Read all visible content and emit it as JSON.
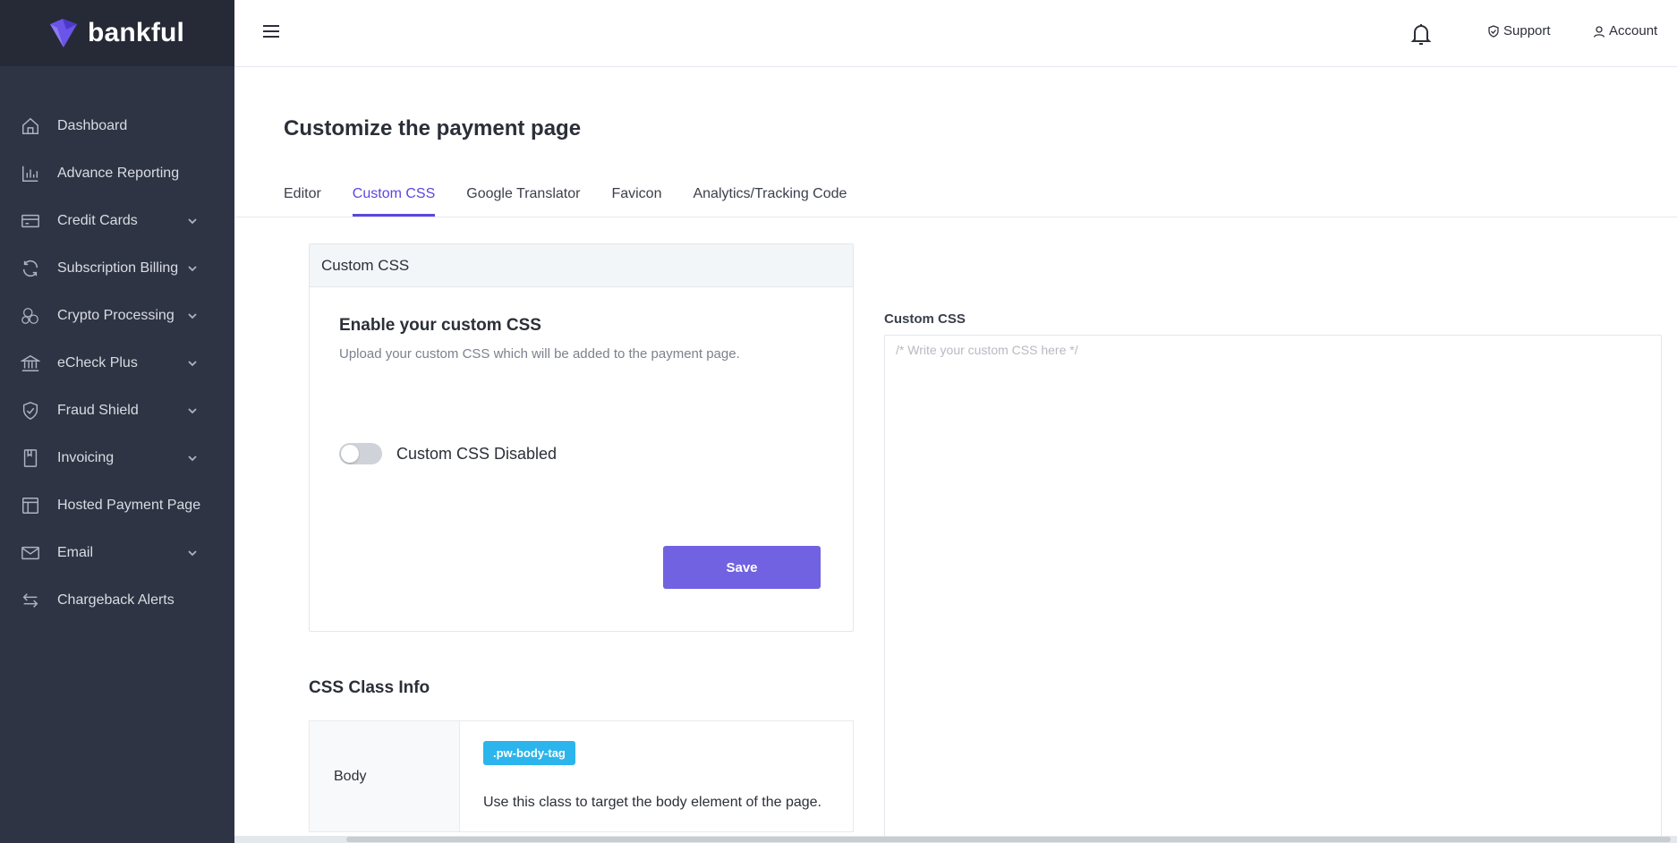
{
  "brand": {
    "name": "bankful",
    "color": "#6a55e8"
  },
  "sidebar": {
    "items": [
      {
        "label": "Dashboard",
        "icon": "home-icon",
        "has_submenu": false
      },
      {
        "label": "Advance Reporting",
        "icon": "bar-chart-icon",
        "has_submenu": false
      },
      {
        "label": "Credit Cards",
        "icon": "credit-card-icon",
        "has_submenu": true
      },
      {
        "label": "Subscription Billing",
        "icon": "refresh-icon",
        "has_submenu": true
      },
      {
        "label": "Crypto Processing",
        "icon": "crypto-coins-icon",
        "has_submenu": true
      },
      {
        "label": "eCheck Plus",
        "icon": "bank-icon",
        "has_submenu": true
      },
      {
        "label": "Fraud Shield",
        "icon": "shield-check-icon",
        "has_submenu": true
      },
      {
        "label": "Invoicing",
        "icon": "invoice-icon",
        "has_submenu": true
      },
      {
        "label": "Hosted Payment Page",
        "icon": "layout-icon",
        "has_submenu": false
      },
      {
        "label": "Email",
        "icon": "mail-icon",
        "has_submenu": true
      },
      {
        "label": "Chargeback Alerts",
        "icon": "arrows-icon",
        "has_submenu": false
      }
    ]
  },
  "topbar": {
    "support_label": "Support",
    "account_label": "Account"
  },
  "page": {
    "title": "Customize the payment page",
    "tabs": [
      {
        "label": "Editor",
        "active": false
      },
      {
        "label": "Custom CSS",
        "active": true
      },
      {
        "label": "Google Translator",
        "active": false
      },
      {
        "label": "Favicon",
        "active": false
      },
      {
        "label": "Analytics/Tracking Code",
        "active": false
      }
    ]
  },
  "card": {
    "header": "Custom CSS",
    "title": "Enable your custom CSS",
    "subtitle": "Upload your custom CSS which will be added to the payment page.",
    "toggle_label": "Custom CSS Disabled",
    "toggle_on": false,
    "save_label": "Save"
  },
  "class_info": {
    "title": "CSS Class Info",
    "rows": [
      {
        "name": "Body",
        "tag": ".pw-body-tag",
        "description": "Use this class to target the body element of the page."
      }
    ]
  },
  "editor": {
    "label": "Custom CSS",
    "placeholder": "/* Write your custom CSS here */",
    "value": ""
  },
  "colors": {
    "accent": "#5b46e0",
    "button": "#7062e0",
    "tag": "#2bb5ec",
    "sidebar_bg": "#2f3444"
  }
}
